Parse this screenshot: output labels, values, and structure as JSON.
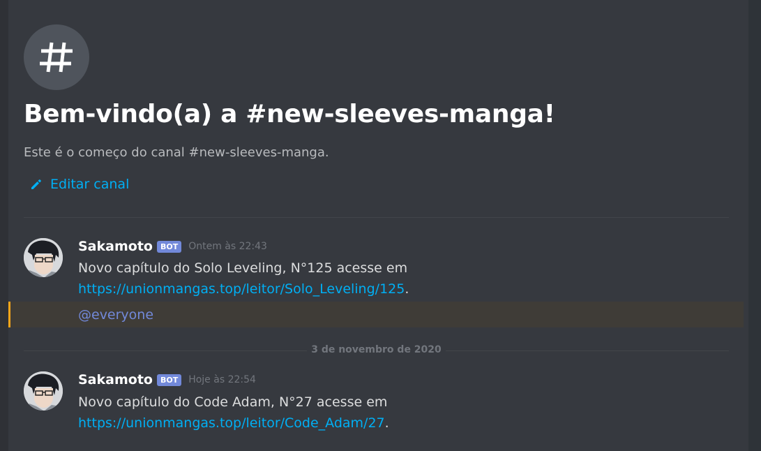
{
  "channel": {
    "icon": "hash-icon",
    "welcome_title": "Bem-vindo(a) a #new-sleeves-manga!",
    "welcome_subtitle": "Este é o começo do canal #new-sleeves-manga.",
    "edit_label": "Editar canal"
  },
  "messages": [
    {
      "username": "Sakamoto",
      "badge": "BOT",
      "timestamp": "Ontem às 22:43",
      "text": "Novo capítulo do Solo Leveling, N°125 acesse em",
      "link": "https://unionmangas.top/leitor/Solo_Leveling/125",
      "link_suffix": ".",
      "mention": "@everyone"
    },
    {
      "username": "Sakamoto",
      "badge": "BOT",
      "timestamp": "Hoje às 22:54",
      "text": "Novo capítulo do Code Adam, N°27 acesse em",
      "link": "https://unionmangas.top/leitor/Code_Adam/27",
      "link_suffix": "."
    }
  ],
  "date_divider": "3 de novembro de 2020",
  "colors": {
    "background": "#36393f",
    "link": "#00aff4",
    "bot_badge": "#7289da",
    "mention_highlight": "#faa61a",
    "mention_text": "#7289da"
  }
}
